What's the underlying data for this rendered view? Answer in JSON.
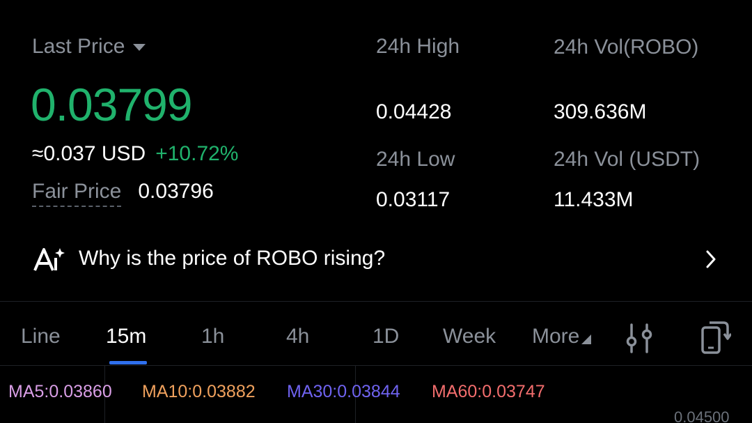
{
  "ticker": {
    "last_price_label": "Last Price",
    "last_price": "0.03799",
    "usd_value": "≈0.037 USD",
    "change_pct": "+10.72%",
    "fair_price_label": "Fair Price",
    "fair_price": "0.03796",
    "high_label": "24h High",
    "high_value": "0.04428",
    "low_label": "24h Low",
    "low_value": "0.03117",
    "vol_base_label": "24h Vol(ROBO)",
    "vol_base_value": "309.636M",
    "vol_quote_label": "24h Vol (USDT)",
    "vol_quote_value": "11.433M"
  },
  "ai_prompt": {
    "icon": "ai-sparkle-icon",
    "text": "Why is the price of ROBO rising?",
    "chevron": "chevron-right-icon"
  },
  "chart_tabs": {
    "items": [
      {
        "label": "Line",
        "active": false
      },
      {
        "label": "15m",
        "active": true
      },
      {
        "label": "1h",
        "active": false
      },
      {
        "label": "4h",
        "active": false
      },
      {
        "label": "1D",
        "active": false
      },
      {
        "label": "Week",
        "active": false
      },
      {
        "label": "More",
        "active": false
      }
    ],
    "indicator_icon": "indicator-settings-icon",
    "rotate_icon": "rotate-screen-icon"
  },
  "moving_averages": {
    "ma5": "MA5:0.03860",
    "ma10": "MA10:0.03882",
    "ma30": "MA30:0.03844",
    "ma60": "MA60:0.03747"
  },
  "price_axis_top": "0.04500",
  "colors": {
    "up_green": "#20b26c",
    "active_underline": "#2f6fed",
    "ma5": "#d99ee6",
    "ma10": "#f0a15d",
    "ma30": "#6f63f0",
    "ma60": "#f26d6d"
  }
}
